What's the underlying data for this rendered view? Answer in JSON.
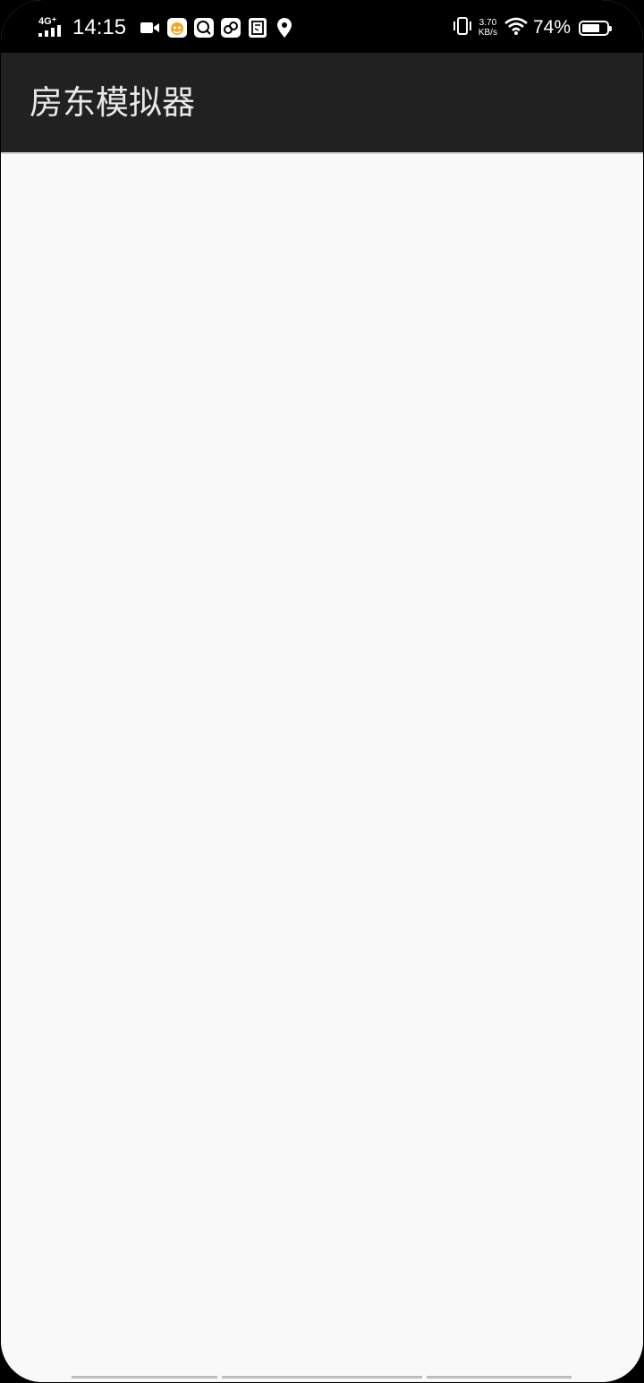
{
  "status_bar": {
    "network_label": "4G⁺",
    "time": "14:15",
    "notification_icons": [
      "video-camera-icon",
      "ucloud-app-icon",
      "search-du-icon",
      "link-app-icon",
      "notes-app-icon",
      "location-du-icon"
    ],
    "vibrate_icon": "vibrate-icon",
    "speed_value": "3.70",
    "speed_unit": "KB/s",
    "wifi_icon": "wifi-icon",
    "battery_percent": "74%",
    "battery_level": 0.74
  },
  "app_bar": {
    "title": "房东模拟器",
    "background": "#212121"
  },
  "content": {
    "background": "#f9f9f9"
  }
}
